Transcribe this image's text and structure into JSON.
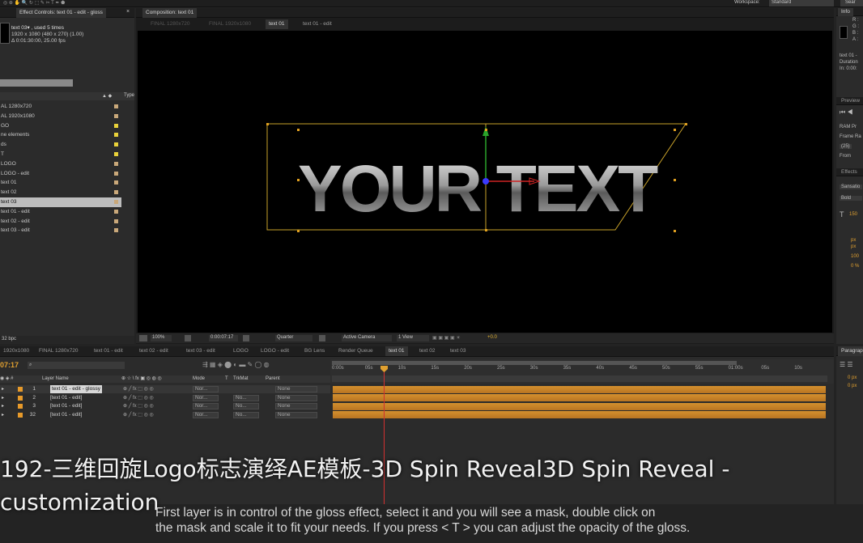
{
  "top_bar": {
    "workspace_label": "Workspace:",
    "workspace_value": "Standard",
    "search": "Sear"
  },
  "effect_controls": {
    "tab": "Effect Controls: text 01 - edit - gloss"
  },
  "project": {
    "item_name": "text 03▾ , used 5 times",
    "item_size": "1920 x 1080  (480 x 270) (1.00)",
    "item_duration": "Δ 0:01:30:00, 25.00 fps",
    "type_header": "Type",
    "items": [
      {
        "label": "AL 1280x720",
        "color": "#c9a87a"
      },
      {
        "label": "AL 1920x1080",
        "color": "#c9a87a"
      },
      {
        "label": "GO",
        "color": "#e9d23a"
      },
      {
        "label": "ne elements",
        "color": "#e9d23a"
      },
      {
        "label": "ds",
        "color": "#e9d23a"
      },
      {
        "label": "T",
        "color": "#e9d23a"
      },
      {
        "label": "LOGO",
        "color": "#c9a87a"
      },
      {
        "label": "LOGO - edit",
        "color": "#c9a87a"
      },
      {
        "label": "text 01",
        "color": "#c9a87a"
      },
      {
        "label": "text 02",
        "color": "#c9a87a"
      },
      {
        "label": "text 03",
        "color": "#c9a87a",
        "selected": true
      },
      {
        "label": "text 01 - edit",
        "color": "#c9a87a"
      },
      {
        "label": "text 02 - edit",
        "color": "#c9a87a"
      },
      {
        "label": "text 03 - edit",
        "color": "#c9a87a"
      }
    ],
    "bpc": "32 bpc"
  },
  "composition": {
    "tab": "Composition: text 01",
    "breadcrumbs": [
      "FINAL 1280x720",
      "FINAL 1920x1080",
      "text 01",
      "text 01 - edit"
    ],
    "canvas_text": "YOUR TEXT",
    "bottom": {
      "zoom": "100%",
      "timecode": "0:00:07:17",
      "resolution": "Quarter",
      "camera": "Active Camera",
      "view": "1 View",
      "exposure": "+0.0"
    }
  },
  "info_panel": {
    "tab": "Info",
    "channels": [
      "R :",
      "G :",
      "B :",
      "A :"
    ],
    "lines": [
      "text 01 -",
      "Duration",
      "In: 0:00:"
    ]
  },
  "preview_panel": {
    "tab": "Preview",
    "ram": "RAM Pr",
    "frame_rate": "Frame Ra",
    "frame_rate_value": "(25)",
    "from": "From"
  },
  "effects_panel": {
    "tab": "Effects",
    "font": "Sansatio",
    "style": "Bold",
    "size": "150",
    "values": [
      "px",
      "px",
      "100",
      "0 %"
    ]
  },
  "paragraph_panel": {
    "tab": "Paragrap",
    "values": [
      "0 px",
      "0 px"
    ]
  },
  "timeline": {
    "tabs": [
      "1920x1080",
      "FINAL 1280x720",
      "text 01 - edit",
      "text 02 - edit",
      "text 03 - edit",
      "LOGO",
      "LOGO - edit",
      "BG Lens",
      "Render Queue",
      "text 01",
      "text 02",
      "text 03"
    ],
    "active_tab": "text 01",
    "timecode": "07:17",
    "headers": {
      "layer_name": "Layer Name",
      "mode": "Mode",
      "t": "T",
      "trkmat": "TrkMat",
      "parent": "Parent"
    },
    "layers": [
      {
        "num": "1",
        "name": "text 01 - edit - glossy",
        "mode": "Nor...",
        "trkmat": "",
        "parent": "None",
        "selected": true
      },
      {
        "num": "2",
        "name": "[text 01 - edit]",
        "mode": "Nor...",
        "trkmat": "No...",
        "parent": "None"
      },
      {
        "num": "3",
        "name": "[text 01 - edit]",
        "mode": "Nor...",
        "trkmat": "No...",
        "parent": "None"
      },
      {
        "num": "32",
        "name": "[text 01 - edit]",
        "mode": "Nor...",
        "trkmat": "No...",
        "parent": "None"
      }
    ],
    "ruler": [
      "0:00s",
      "05s",
      "10s",
      "15s",
      "20s",
      "25s",
      "30s",
      "35s",
      "40s",
      "45s",
      "50s",
      "55s",
      "01:00s",
      "05s",
      "10s"
    ]
  },
  "overlay": {
    "title_line1": "192-三维回旋Logo标志演绎AE模板-3D Spin Reveal3D Spin Reveal -",
    "title_line2": "customization",
    "subtitle_line1": "First layer is in control of the gloss effect, select it and you will see a mask, double click on",
    "subtitle_line2": "the mask and scale it to fit your needs. If you press < T > you can adjust the opacity of the gloss."
  }
}
